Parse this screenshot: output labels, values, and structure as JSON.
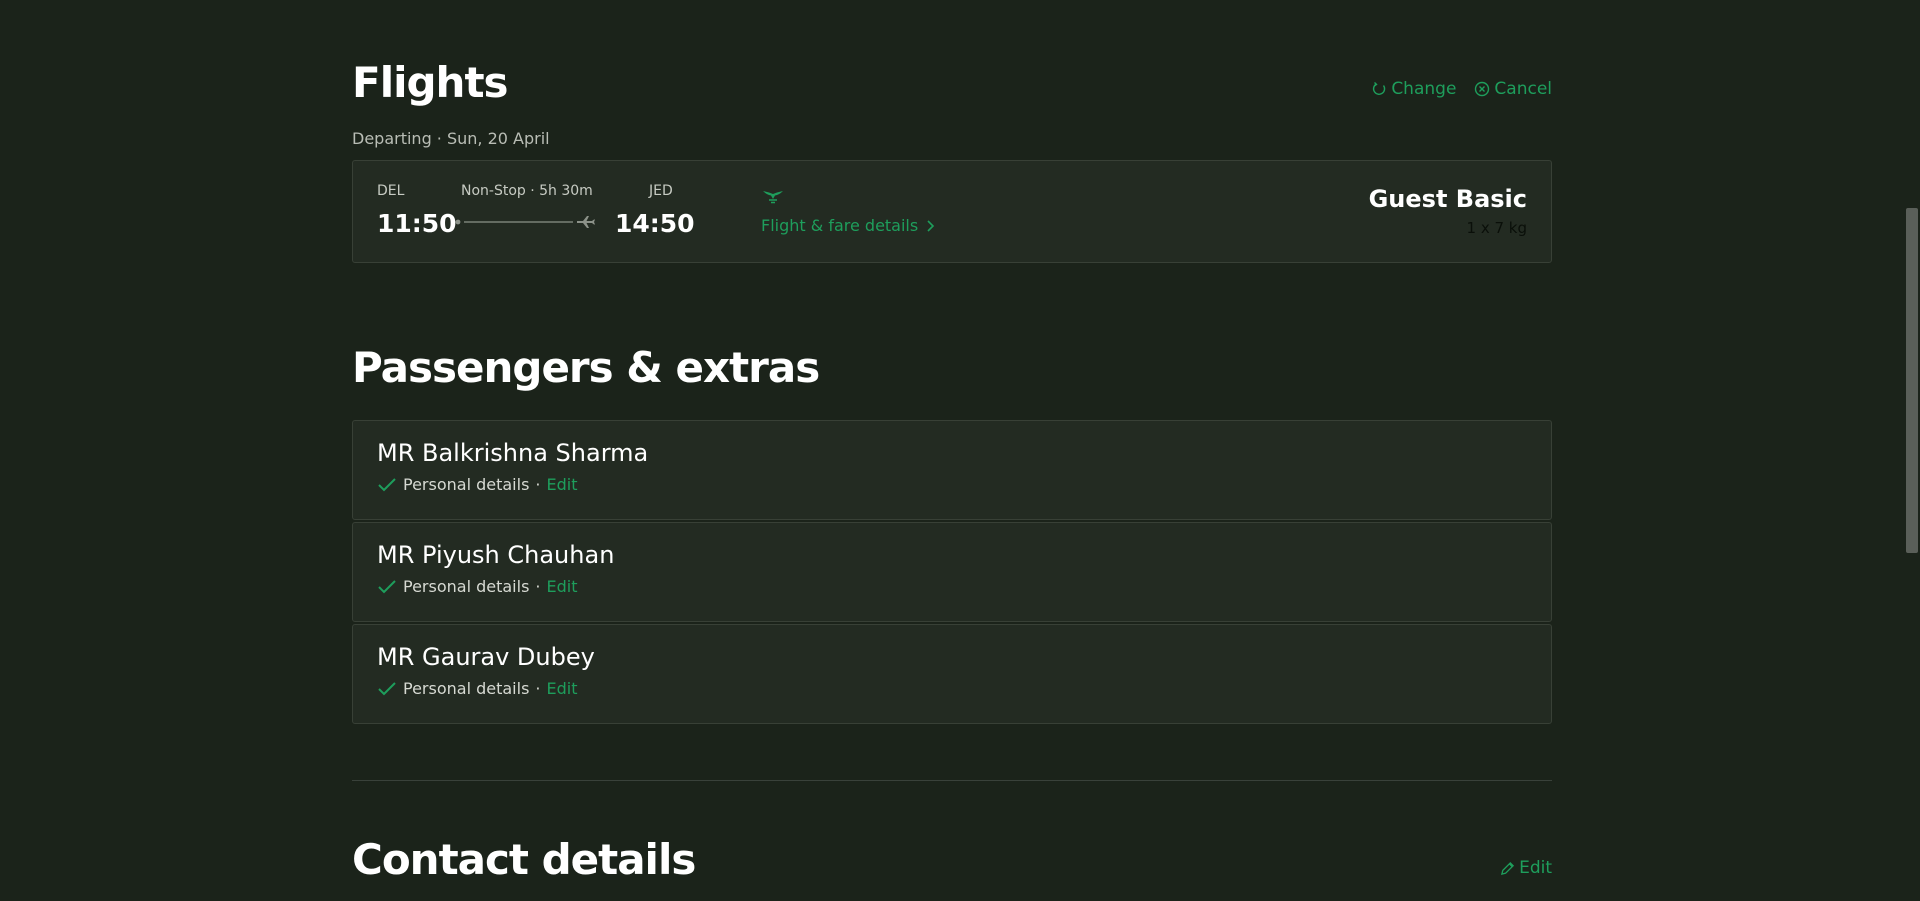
{
  "flights": {
    "title": "Flights",
    "change_label": "Change",
    "cancel_label": "Cancel",
    "departing_label": "Departing · Sun, 20 April",
    "origin_code": "DEL",
    "origin_time": "11:50",
    "dest_code": "JED",
    "dest_time": "14:50",
    "stops_duration": "Non-Stop · 5h 30m",
    "fare_details_label": "Flight & fare details",
    "fare_name": "Guest Basic",
    "baggage": "1 x 7 kg"
  },
  "passengers": {
    "title": "Passengers & extras",
    "items": [
      {
        "name": "MR Balkrishna Sharma",
        "status": "Personal details",
        "separator": "·",
        "edit_label": "Edit"
      },
      {
        "name": "MR Piyush Chauhan",
        "status": "Personal details",
        "separator": "·",
        "edit_label": "Edit"
      },
      {
        "name": "MR Gaurav Dubey",
        "status": "Personal details",
        "separator": "·",
        "edit_label": "Edit"
      }
    ]
  },
  "contact": {
    "title": "Contact details",
    "edit_label": "Edit"
  },
  "colors": {
    "background": "#1b231a",
    "card": "#232b22",
    "accent": "#1e9e5c"
  },
  "icons": [
    "refresh-icon",
    "cancel-circle-icon",
    "airline-logo-icon",
    "plane-icon",
    "chevron-right-icon",
    "check-icon",
    "pencil-icon"
  ]
}
